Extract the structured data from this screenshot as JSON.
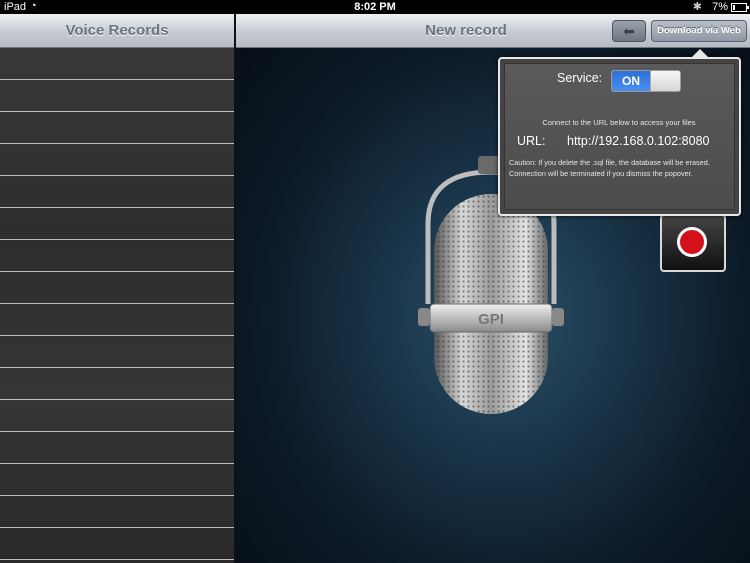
{
  "status": {
    "carrier": "iPad",
    "time": "8:02 PM",
    "battery": "7%"
  },
  "left_pane": {
    "title": "Voice Records",
    "row_count": 16
  },
  "right_pane": {
    "title": "New record",
    "back_icon": "back-arrow-icon",
    "download_button": "Download via Web",
    "mic_brand": "GPI"
  },
  "popover": {
    "service_label": "Service:",
    "toggle_label": "ON",
    "connect_text": "Connect to the URL below to access your files",
    "url_label": "URL:",
    "url_value": "http://192.168.0.102:8080",
    "caution_1": "Caution: If you delete the .sql file, the database will be erased.",
    "caution_2": "Connection will be terminated if you dismiss the popover."
  },
  "colors": {
    "record_red": "#d4101b",
    "toggle_blue": "#2e6fd6"
  }
}
